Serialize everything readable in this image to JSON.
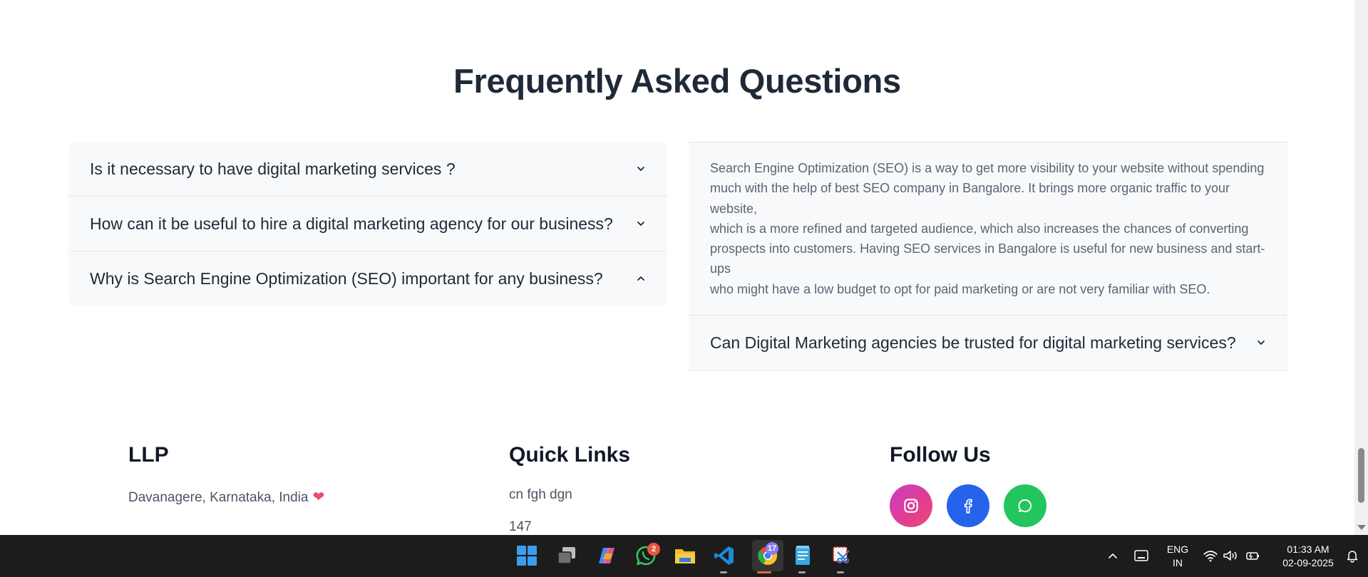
{
  "faq": {
    "title": "Frequently Asked Questions",
    "left": [
      {
        "question": "Is it necessary to have digital marketing services ?",
        "expanded": false
      },
      {
        "question": "How can it be useful to hire a digital marketing agency for our business?",
        "expanded": false
      },
      {
        "question": "Why is Search Engine Optimization (SEO) important for any business?",
        "expanded": true
      }
    ],
    "right": {
      "answer_lines": [
        "Search Engine Optimization (SEO) is a way to get more visibility to your website without spending",
        "much with the help of best SEO company in Bangalore. It brings more organic traffic to your website,",
        "which is a more refined and targeted audience, which also increases the chances of converting",
        "prospects into customers. Having SEO services in Bangalore is useful for new business and start-ups",
        "who might have a low budget to opt for paid marketing or are not very familiar with SEO."
      ],
      "question": "Can Digital Marketing agencies be trusted for digital marketing services?"
    }
  },
  "footer": {
    "llp": {
      "heading": "LLP",
      "address": "Davanagere, Karnataka, India",
      "heart": "❤"
    },
    "quick_links": {
      "heading": "Quick Links",
      "items": [
        "cn fgh dgn",
        "147"
      ]
    },
    "follow": {
      "heading": "Follow Us",
      "icons": [
        "instagram-icon",
        "facebook-icon",
        "whatsapp-icon"
      ]
    }
  },
  "taskbar": {
    "apps": [
      "windows-start",
      "task-view",
      "copilot",
      "whatsapp",
      "file-explorer",
      "vscode",
      "chrome",
      "notepad",
      "snipping-tool"
    ],
    "whatsapp_badge": "2",
    "chrome_badge": "17",
    "tray": {
      "lang_line1": "ENG",
      "lang_line2": "IN",
      "time": "01:33 AM",
      "date": "02-09-2025"
    }
  },
  "colors": {
    "heading": "#1f2937",
    "faq_bg": "#f8f9fb",
    "instagram": "#d9408f",
    "facebook": "#2563eb",
    "whatsapp": "#22c55e",
    "taskbar": "#1c1c1c"
  }
}
